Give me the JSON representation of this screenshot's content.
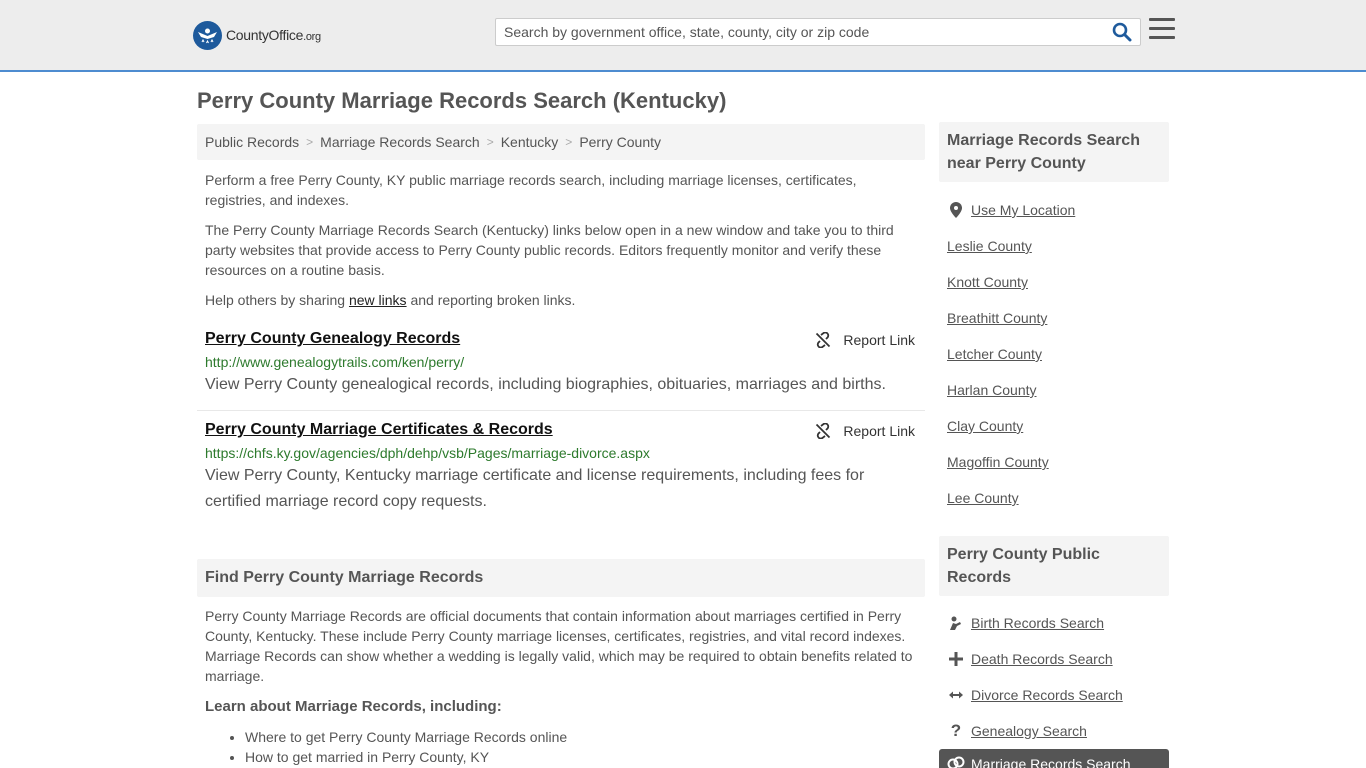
{
  "header": {
    "logo_text": "CountyOffice",
    "logo_tld": ".org",
    "search_placeholder": "Search by government office, state, county, city or zip code"
  },
  "page_title": "Perry County Marriage Records Search (Kentucky)",
  "breadcrumb": [
    "Public Records",
    "Marriage Records Search",
    "Kentucky",
    "Perry County"
  ],
  "intro": {
    "p1": "Perform a free Perry County, KY public marriage records search, including marriage licenses, certificates, registries, and indexes.",
    "p2": "The Perry County Marriage Records Search (Kentucky) links below open in a new window and take you to third party websites that provide access to Perry County public records. Editors frequently monitor and verify these resources on a routine basis.",
    "p3_before": "Help others by sharing ",
    "p3_link": "new links",
    "p3_after": " and reporting broken links."
  },
  "results": [
    {
      "title": "Perry County Genealogy Records",
      "url": "http://www.genealogytrails.com/ken/perry/",
      "desc": "View Perry County genealogical records, including biographies, obituaries, marriages and births.",
      "report_label": "Report Link"
    },
    {
      "title": "Perry County Marriage Certificates & Records",
      "url": "https://chfs.ky.gov/agencies/dph/dehp/vsb/Pages/marriage-divorce.aspx",
      "desc": "View Perry County, Kentucky marriage certificate and license requirements, including fees for certified marriage record copy requests.",
      "report_label": "Report Link"
    }
  ],
  "find_section": {
    "heading": "Find Perry County Marriage Records",
    "body": "Perry County Marriage Records are official documents that contain information about marriages certified in Perry County, Kentucky. These include Perry County marriage licenses, certificates, registries, and vital record indexes. Marriage Records can show whether a wedding is legally valid, which may be required to obtain benefits related to marriage.",
    "learn_heading": "Learn about Marriage Records, including:",
    "bullets": [
      "Where to get Perry County Marriage Records online",
      "How to get married in Perry County, KY"
    ]
  },
  "sidebar": {
    "nearby_heading": "Marriage Records Search near Perry County",
    "use_location": "Use My Location",
    "nearby": [
      "Leslie County",
      "Knott County",
      "Breathitt County",
      "Letcher County",
      "Harlan County",
      "Clay County",
      "Magoffin County",
      "Lee County"
    ],
    "public_heading": "Perry County Public Records",
    "public_links": [
      {
        "label": "Birth Records Search",
        "icon": "baby-icon"
      },
      {
        "label": "Death Records Search",
        "icon": "cross-icon"
      },
      {
        "label": "Divorce Records Search",
        "icon": "split-arrows-icon"
      },
      {
        "label": "Genealogy Search",
        "icon": "question-icon"
      }
    ],
    "active_link": "Marriage Records Search"
  }
}
